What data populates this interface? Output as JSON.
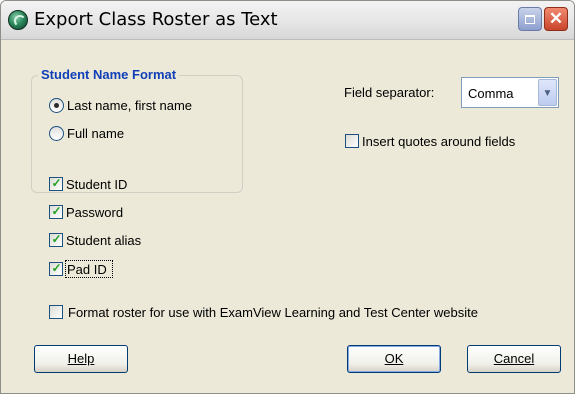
{
  "window": {
    "title": "Export Class Roster as Text"
  },
  "name_format": {
    "group_label": "Student Name Format",
    "options": [
      {
        "label": "Last name, first name",
        "selected": true
      },
      {
        "label": "Full name",
        "selected": false
      }
    ]
  },
  "field_separator": {
    "label": "Field separator:",
    "value": "Comma"
  },
  "insert_quotes": {
    "label": "Insert quotes around fields",
    "checked": false
  },
  "fields": [
    {
      "label": "Student ID",
      "checked": true
    },
    {
      "label": "Password",
      "checked": true
    },
    {
      "label": "Student alias",
      "checked": true
    },
    {
      "label": "Pad ID",
      "checked": true
    }
  ],
  "format_roster": {
    "label": "Format roster for use with ExamView Learning and Test Center website",
    "checked": false
  },
  "buttons": {
    "help": "Help",
    "ok": "OK",
    "cancel": "Cancel"
  }
}
